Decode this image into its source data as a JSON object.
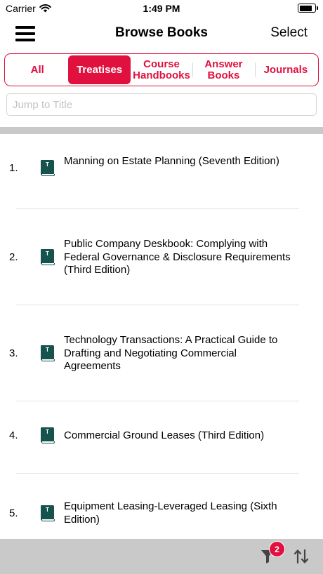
{
  "status_bar": {
    "carrier": "Carrier",
    "time": "1:49 PM",
    "wifi_icon": "wifi-icon",
    "battery_icon": "battery-icon"
  },
  "nav": {
    "menu_icon": "hamburger-menu-icon",
    "title": "Browse Books",
    "select_label": "Select"
  },
  "tabs": [
    {
      "label": "All",
      "active": false
    },
    {
      "label": "Treatises",
      "active": true
    },
    {
      "label": "Course Handbooks",
      "active": false
    },
    {
      "label": "Answer Books",
      "active": false
    },
    {
      "label": "Journals",
      "active": false
    }
  ],
  "search": {
    "placeholder": "Jump to Title",
    "value": ""
  },
  "books": [
    {
      "number": "1.",
      "icon_letter": "T",
      "title": "Manning on Estate Planning (Seventh Edition)"
    },
    {
      "number": "2.",
      "icon_letter": "T",
      "title": "Public Company Deskbook: Complying with Federal Governance & Disclosure Requirements (Third Edition)"
    },
    {
      "number": "3.",
      "icon_letter": "T",
      "title": "Technology Transactions: A Practical Guide to Drafting and Negotiating Commercial Agreements"
    },
    {
      "number": "4.",
      "icon_letter": "T",
      "title": "Commercial Ground Leases (Third Edition)"
    },
    {
      "number": "5.",
      "icon_letter": "T",
      "title": "Equipment Leasing-Leveraged Leasing (Sixth Edition)"
    }
  ],
  "toolbar": {
    "filter_icon": "filter-funnel-icon",
    "filter_count": "2",
    "sort_icon": "sort-arrows-icon"
  },
  "colors": {
    "accent": "#e0103f",
    "book_icon": "#16534f",
    "toolbar_bg": "#c9c9c9"
  }
}
